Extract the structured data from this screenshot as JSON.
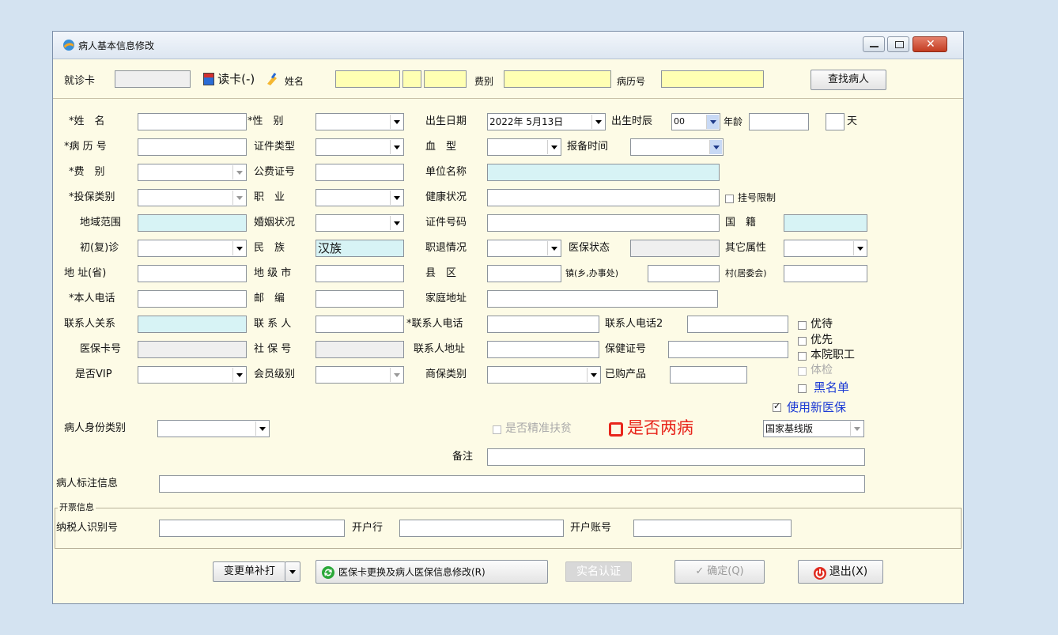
{
  "window": {
    "title": "病人基本信息修改"
  },
  "topbar": {
    "card_label": "就诊卡",
    "card_value": "",
    "read_card": "读卡(-)",
    "name_label": "姓名",
    "name_value": "",
    "fee_label": "费别",
    "fee_value": "",
    "record_label": "病历号",
    "record_value": "",
    "find": "查找病人"
  },
  "form": {
    "name": {
      "label": "*姓　名",
      "value": ""
    },
    "gender": {
      "label": "*性　别",
      "value": ""
    },
    "birth_date": {
      "label": "出生日期",
      "value": "2022年 5月13日"
    },
    "birth_time": {
      "label": "出生时辰",
      "value": "00"
    },
    "age": {
      "label": "年龄",
      "value": ""
    },
    "day": {
      "label": "天",
      "value": ""
    },
    "record_no": {
      "label": "*病 历 号",
      "value": ""
    },
    "id_type": {
      "label": "证件类型",
      "value": ""
    },
    "blood": {
      "label": "血　型",
      "value": ""
    },
    "report_time": {
      "label": "报备时间",
      "value": ""
    },
    "fee": {
      "label": "*费　别",
      "value": ""
    },
    "public_fee_no": {
      "label": "公费证号",
      "value": ""
    },
    "unit": {
      "label": "单位名称",
      "value": ""
    },
    "insurance_type": {
      "label": "*投保类别",
      "value": ""
    },
    "job": {
      "label": "职　业",
      "value": ""
    },
    "health": {
      "label": "健康状况",
      "value": ""
    },
    "reg_limit": {
      "label": "挂号限制"
    },
    "region": {
      "label": "地域范围",
      "value": ""
    },
    "marriage": {
      "label": "婚姻状况",
      "value": ""
    },
    "id_no": {
      "label": "证件号码",
      "value": ""
    },
    "nationality": {
      "label": "国　籍",
      "value": ""
    },
    "visit": {
      "label": "初(复)诊",
      "value": ""
    },
    "ethnic": {
      "label": "民　族",
      "value": "汉族"
    },
    "retire": {
      "label": "职退情况",
      "value": ""
    },
    "ins_status": {
      "label": "医保状态",
      "value": ""
    },
    "other_attr": {
      "label": "其它属性",
      "value": ""
    },
    "province": {
      "label": "地 址(省)",
      "value": ""
    },
    "city": {
      "label": "地 级 市",
      "value": ""
    },
    "county": {
      "label": "县　区",
      "value": ""
    },
    "town": {
      "label": "镇(乡,办事处)",
      "value": ""
    },
    "village": {
      "label": "村(居委会)",
      "value": ""
    },
    "phone": {
      "label": "*本人电话",
      "value": ""
    },
    "postcode": {
      "label": "邮　编",
      "value": ""
    },
    "home_addr": {
      "label": "家庭地址",
      "value": ""
    },
    "contact_rel": {
      "label": "联系人关系",
      "value": ""
    },
    "contact": {
      "label": "联 系 人",
      "value": ""
    },
    "contact_phone": {
      "label": "*联系人电话",
      "value": ""
    },
    "contact_phone2": {
      "label": "联系人电话2",
      "value": ""
    },
    "ins_card": {
      "label": "医保卡号",
      "value": ""
    },
    "social": {
      "label": "社 保 号",
      "value": ""
    },
    "contact_addr": {
      "label": "联系人地址",
      "value": ""
    },
    "health_card": {
      "label": "保健证号",
      "value": ""
    },
    "vip": {
      "label": "是否VIP",
      "value": ""
    },
    "member": {
      "label": "会员级别",
      "value": ""
    },
    "com_ins": {
      "label": "商保类别",
      "value": ""
    },
    "product": {
      "label": "已购产品",
      "value": ""
    },
    "identity": {
      "label": "病人身份类别",
      "value": ""
    },
    "poverty": {
      "label": "是否精准扶贫"
    },
    "two_disease": {
      "label": "是否两病"
    },
    "version": {
      "value": "国家基线版"
    },
    "remark": {
      "label": "备注",
      "value": ""
    },
    "mark_info": {
      "label": "病人标注信息",
      "value": ""
    }
  },
  "flags": {
    "youdai": "优待",
    "youxian": "优先",
    "staff": "本院职工",
    "exam": "体检",
    "blacklist": "黑名单",
    "new_ins": "使用新医保"
  },
  "invoice": {
    "group_title": "开票信息",
    "taxpayer": {
      "label": "纳税人识别号",
      "value": ""
    },
    "bank": {
      "label": "开户行",
      "value": ""
    },
    "account": {
      "label": "开户账号",
      "value": ""
    }
  },
  "footer": {
    "reprint": "变更单补打",
    "ins_change": "医保卡更换及病人医保信息修改(R)",
    "realname": "实名认证",
    "confirm": "确定(Q)",
    "exit": "退出(X)"
  },
  "colors": {
    "accent_red": "#e8261c",
    "accent_blue": "#1a39d4",
    "field_yellow": "#ffffb3",
    "field_cyan": "#d7f3f5"
  }
}
